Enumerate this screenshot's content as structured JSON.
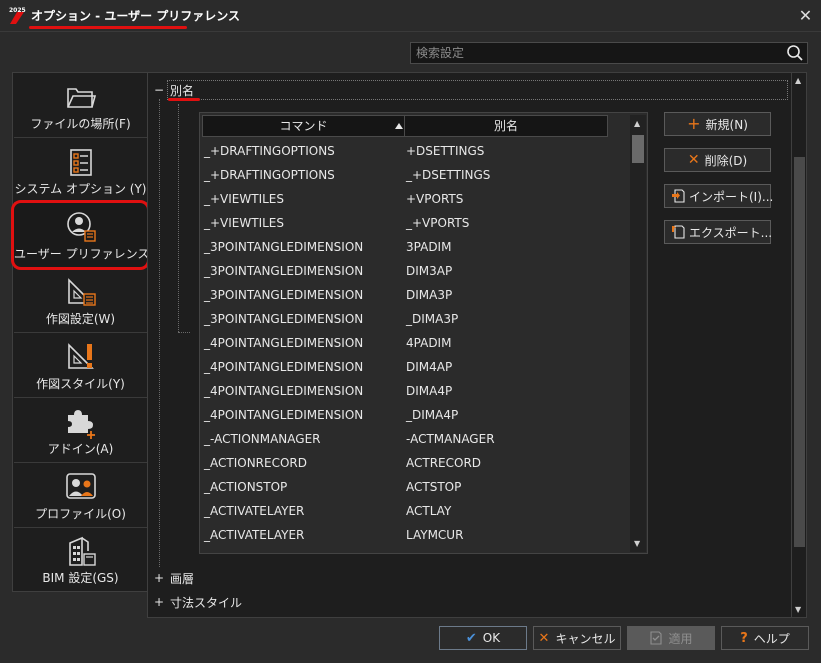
{
  "window": {
    "logo_text": "2025",
    "title": "オプション - ユーザー プリファレンス",
    "close_glyph": "✕"
  },
  "search": {
    "placeholder": "検索設定"
  },
  "sidebar": {
    "items": [
      {
        "label": "ファイルの場所(F)",
        "icon": "folder-icon"
      },
      {
        "label": "システム オプション (Y)",
        "icon": "checklist-icon"
      },
      {
        "label": "ユーザー プリファレンス(U)",
        "icon": "user-preferences-icon",
        "selected": true
      },
      {
        "label": "作図設定(W)",
        "icon": "drafting-settings-icon"
      },
      {
        "label": "作図スタイル(Y)",
        "icon": "drafting-style-icon"
      },
      {
        "label": "アドイン(A)",
        "icon": "puzzle-icon"
      },
      {
        "label": "プロファイル(O)",
        "icon": "profile-icon"
      },
      {
        "label": "BIM 設定(GS)",
        "icon": "building-icon"
      }
    ]
  },
  "sections": {
    "alias": {
      "toggle": "−",
      "title": "別名"
    },
    "layer": {
      "toggle": "+",
      "title": "画層"
    },
    "dimstyle": {
      "toggle": "+",
      "title": "寸法スタイル"
    }
  },
  "grid": {
    "columns": [
      "コマンド",
      "別名"
    ],
    "rows": [
      [
        "_+DRAFTINGOPTIONS",
        "+DSETTINGS"
      ],
      [
        "_+DRAFTINGOPTIONS",
        "_+DSETTINGS"
      ],
      [
        "_+VIEWTILES",
        "+VPORTS"
      ],
      [
        "_+VIEWTILES",
        "_+VPORTS"
      ],
      [
        "_3POINTANGLEDIMENSION",
        "3PADIM"
      ],
      [
        "_3POINTANGLEDIMENSION",
        "DIM3AP"
      ],
      [
        "_3POINTANGLEDIMENSION",
        "DIMA3P"
      ],
      [
        "_3POINTANGLEDIMENSION",
        "_DIMA3P"
      ],
      [
        "_4POINTANGLEDIMENSION",
        "4PADIM"
      ],
      [
        "_4POINTANGLEDIMENSION",
        "DIM4AP"
      ],
      [
        "_4POINTANGLEDIMENSION",
        "DIMA4P"
      ],
      [
        "_4POINTANGLEDIMENSION",
        "_DIMA4P"
      ],
      [
        "_-ACTIONMANAGER",
        "-ACTMANAGER"
      ],
      [
        "_ACTIONRECORD",
        "ACTRECORD"
      ],
      [
        "_ACTIONSTOP",
        "ACTSTOP"
      ],
      [
        "_ACTIVATELAYER",
        "ACTLAY"
      ],
      [
        "_ACTIVATELAYER",
        "LAYMCUR"
      ]
    ]
  },
  "actions": {
    "new": {
      "label": "新規(N)",
      "glyph": "+"
    },
    "delete": {
      "label": "削除(D)",
      "glyph": "✕"
    },
    "import": {
      "label": "インポート(I)..."
    },
    "export": {
      "label": "エクスポート..."
    }
  },
  "footer": {
    "ok": {
      "label": "OK",
      "glyph": "✔"
    },
    "cancel": {
      "label": "キャンセル",
      "glyph": "✕"
    },
    "apply": {
      "label": "適用"
    },
    "help": {
      "label": "ヘルプ",
      "glyph": "?"
    }
  },
  "colors": {
    "accent": "#e8761a",
    "highlight_red": "#e01010",
    "ok_blue": "#4a90d9",
    "background": "#2b2b2b",
    "panel": "#1e1e1e"
  }
}
